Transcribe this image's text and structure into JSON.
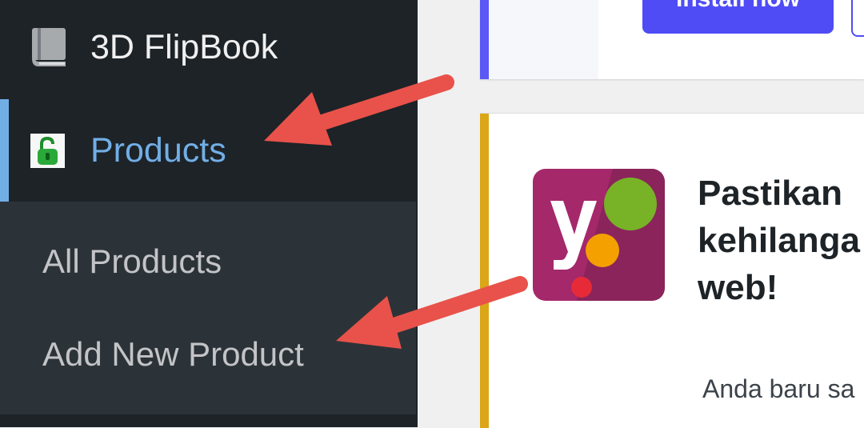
{
  "sidebar": {
    "items": [
      {
        "label": "3D FlipBook",
        "icon": "book-icon"
      },
      {
        "label": "Products",
        "icon": "lock-icon",
        "active": true
      }
    ],
    "submenu": [
      "All Products",
      "Add New Product"
    ]
  },
  "notice_top": {
    "install_label": "Install now"
  },
  "yoast_notice": {
    "heading_lines": [
      "Pastikan",
      "kehilanga",
      "web!"
    ],
    "body": "Anda baru sa"
  },
  "colors": {
    "sidebar_bg": "#1d2327",
    "submenu_bg": "#2c3338",
    "active_accent": "#72aee6",
    "install_button": "#4f4cf6",
    "yoast_accent": "#dba617",
    "arrow": "#e8524a"
  }
}
